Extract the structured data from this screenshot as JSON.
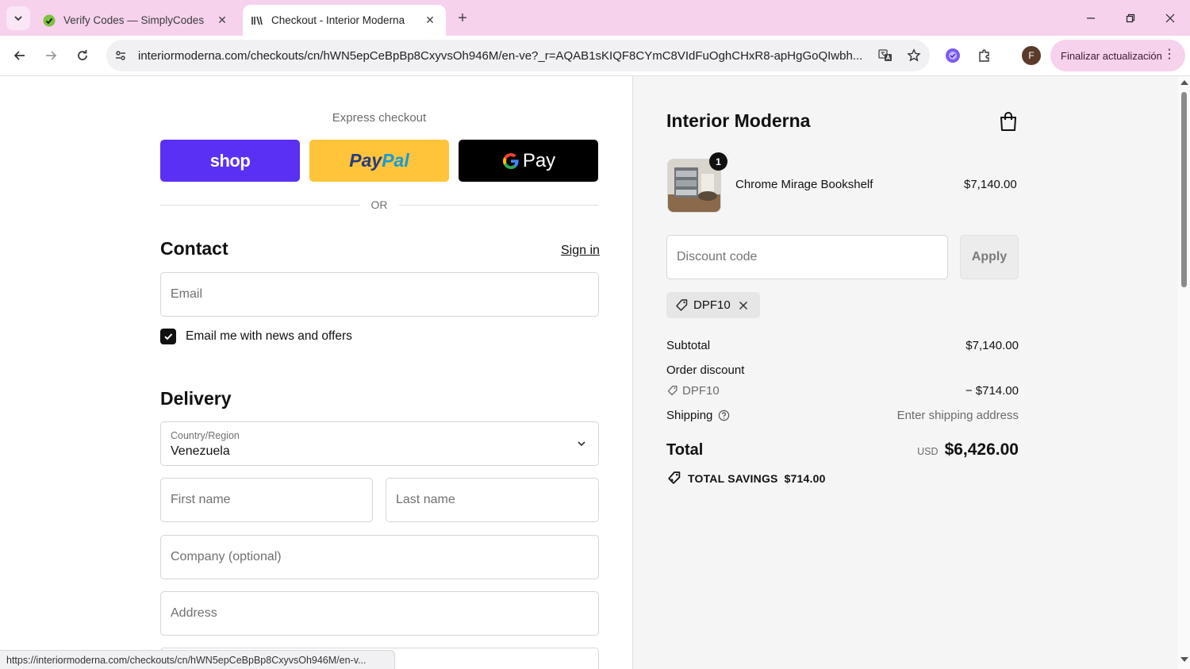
{
  "browser": {
    "tabs": [
      {
        "title": "Verify Codes — SimplyCodes",
        "active": false
      },
      {
        "title": "Checkout - Interior Moderna",
        "active": true
      }
    ],
    "url": "interiormoderna.com/checkouts/cn/hWN5epCeBpBp8CxyvsOh946M/en-ve?_r=AQAB1sKIQF8CYmC8VIdFuOghCHxR8-apHgGoQIwbh...",
    "profile_initial": "F",
    "update_label": "Finalizar actualización",
    "status_url": "https://interiormoderna.com/checkouts/cn/hWN5epCeBpBp8CxyvsOh946M/en-v...",
    "accent": "#f6d2ec"
  },
  "express": {
    "label": "Express checkout",
    "shop_label": "shop",
    "paypal_label": "PayPal",
    "gpay_label": "Pay",
    "or_label": "OR"
  },
  "contact": {
    "title": "Contact",
    "sign_in": "Sign in",
    "email_placeholder": "Email",
    "newsletter_label": "Email me with news and offers",
    "newsletter_checked": true
  },
  "delivery": {
    "title": "Delivery",
    "country_label": "Country/Region",
    "country_value": "Venezuela",
    "first_name_placeholder": "First name",
    "last_name_placeholder": "Last name",
    "company_placeholder": "Company (optional)",
    "address_placeholder": "Address"
  },
  "summary": {
    "store_name": "Interior Moderna",
    "product": {
      "name": "Chrome Mirage Bookshelf",
      "price": "$7,140.00",
      "quantity": "1"
    },
    "discount_placeholder": "Discount code",
    "apply_label": "Apply",
    "applied_code": "DPF10",
    "subtotal_label": "Subtotal",
    "subtotal_value": "$7,140.00",
    "order_discount_label": "Order discount",
    "discount_code": "DPF10",
    "discount_value": "− $714.00",
    "shipping_label": "Shipping",
    "shipping_value": "Enter shipping address",
    "total_label": "Total",
    "total_currency": "USD",
    "total_value": "$6,426.00",
    "savings_label": "TOTAL SAVINGS",
    "savings_value": "$714.00"
  },
  "colors": {
    "shop": "#5a31f4",
    "paypal": "#ffc439",
    "gpay": "#000000"
  }
}
